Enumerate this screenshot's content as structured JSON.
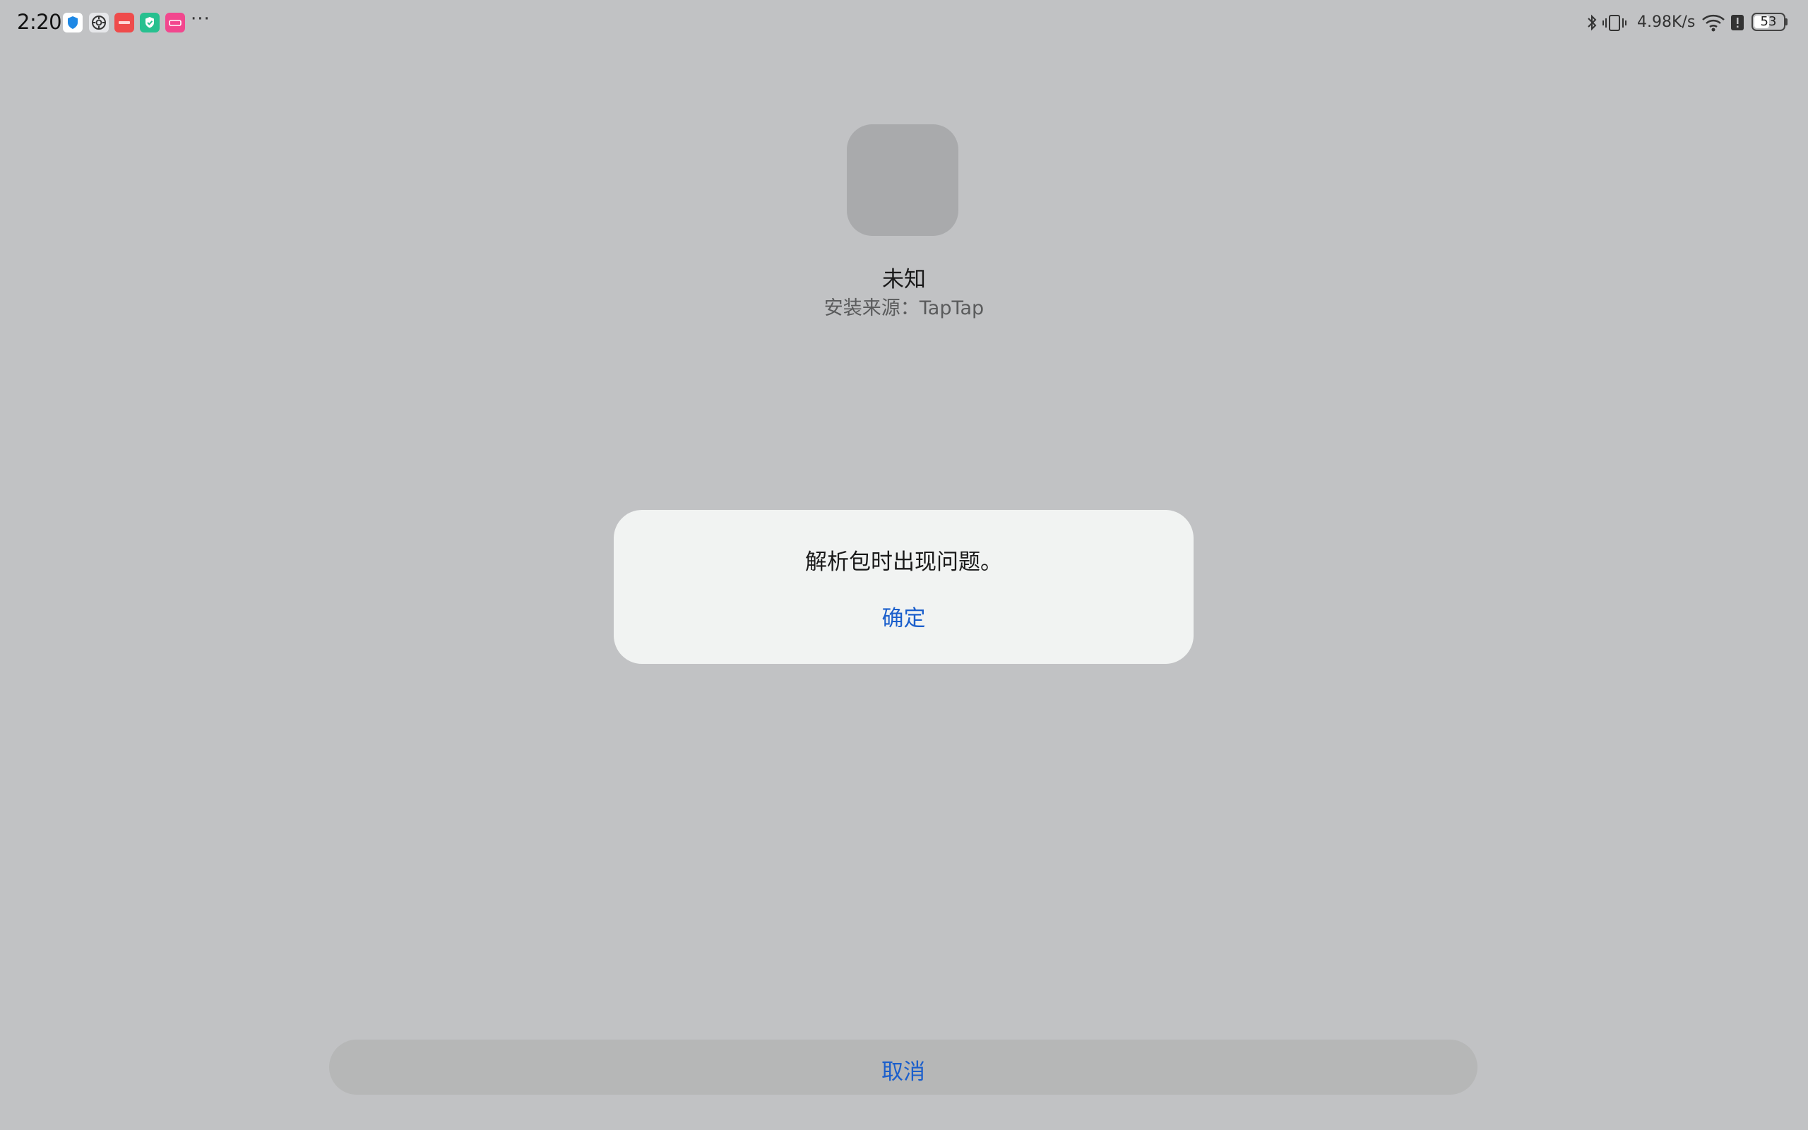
{
  "status_bar": {
    "time": "2:20",
    "more": "···",
    "network_speed": "4.98K/s",
    "battery_level": "53",
    "battery_fraction": 0.53,
    "notification_icons": [
      "shield-app-icon",
      "settings-app-icon",
      "red-app-icon",
      "green-shield-app-icon",
      "pink-app-icon"
    ],
    "status_icons": [
      "bluetooth-icon",
      "vibrate-icon",
      "wifi-icon",
      "alert-icon",
      "battery-icon"
    ]
  },
  "app": {
    "name": "未知",
    "install_source": "安装来源：TapTap"
  },
  "dialog": {
    "message": "解析包时出现问题。",
    "confirm_label": "确定"
  },
  "footer": {
    "cancel_label": "取消"
  },
  "colors": {
    "background": "#c1c2c4",
    "dialog_background": "#f1f3f2",
    "accent": "#1b5fcc"
  }
}
